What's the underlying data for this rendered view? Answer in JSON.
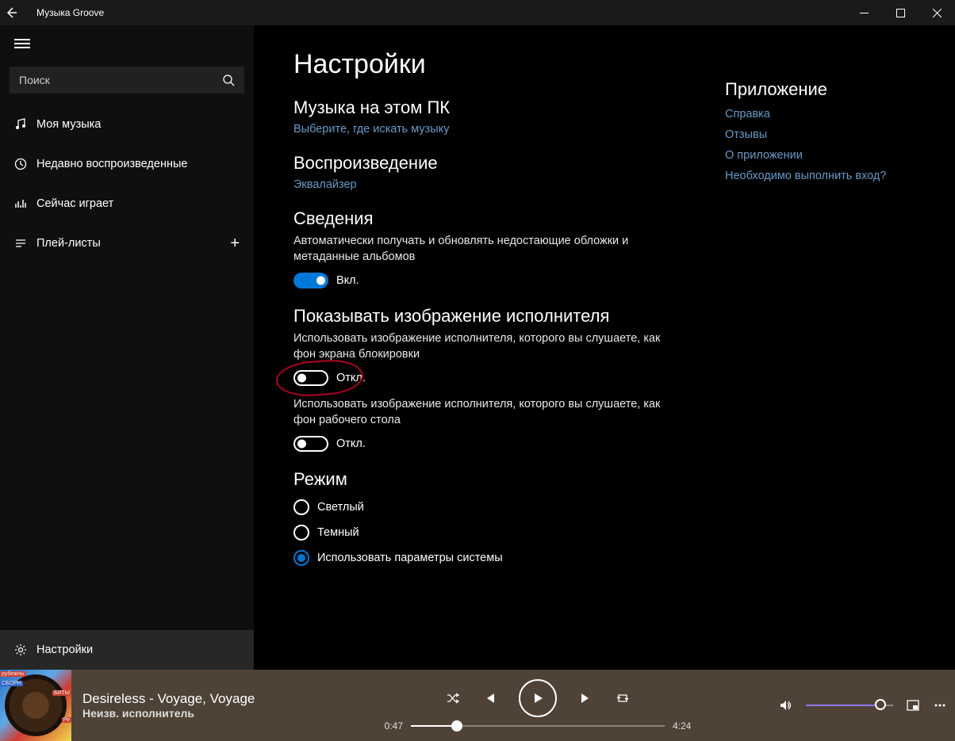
{
  "titlebar": {
    "title": "Музыка Groove"
  },
  "sidebar": {
    "search_placeholder": "Поиск",
    "items": [
      {
        "label": "Моя музыка"
      },
      {
        "label": "Недавно воспроизведенные"
      },
      {
        "label": "Сейчас играет"
      },
      {
        "label": "Плей-листы"
      }
    ],
    "settings_label": "Настройки"
  },
  "page": {
    "title": "Настройки",
    "sections": {
      "local": {
        "heading": "Музыка на этом ПК",
        "link": "Выберите, где искать музыку"
      },
      "playback": {
        "heading": "Воспроизведение",
        "link": "Эквалайзер"
      },
      "info": {
        "heading": "Сведения",
        "desc": "Автоматически получать и обновлять недостающие обложки и метаданные альбомов",
        "toggle_label": "Вкл."
      },
      "artist_image": {
        "heading": "Показывать изображение исполнителя",
        "desc1": "Использовать изображение исполнителя, которого вы слушаете, как фон экрана блокировки",
        "toggle1_label": "Откл.",
        "desc2": "Использовать изображение исполнителя, которого вы слушаете, как фон рабочего стола",
        "toggle2_label": "Откл."
      },
      "mode": {
        "heading": "Режим",
        "options": [
          "Светлый",
          "Темный",
          "Использовать параметры системы"
        ],
        "selected": 2
      }
    },
    "aside": {
      "heading": "Приложение",
      "links": [
        "Справка",
        "Отзывы",
        "О приложении",
        "Необходимо выполнить вход?"
      ]
    }
  },
  "player": {
    "title": "Desireless - Voyage, Voyage",
    "artist": "Неизв. исполнитель",
    "elapsed": "0:47",
    "duration": "4:24",
    "progress_pct": 18,
    "volume_pct": 86
  }
}
